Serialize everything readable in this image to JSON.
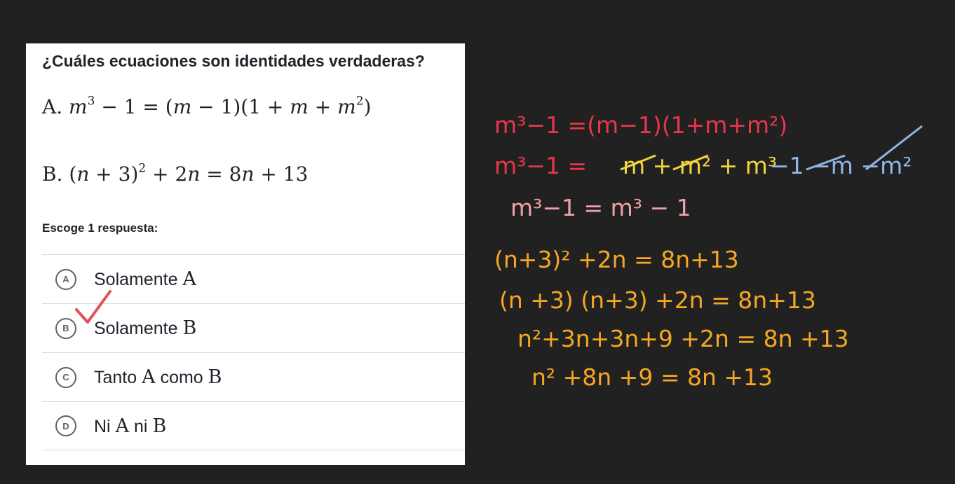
{
  "question": {
    "title": "¿Cuáles ecuaciones son identidades verdaderas?",
    "equation_a": {
      "label": "A.",
      "m": "m",
      "e1": "3",
      "rest1": "− 1 = (",
      "m2": "m",
      "rest2": "− 1)(1 +",
      "m3": "m",
      "rest3": "+",
      "m4": "m",
      "e2": "2",
      "rest4": ")"
    },
    "equation_b": {
      "label": "B.",
      "open": "(",
      "n1": "n",
      "rest1": "+ 3)",
      "e1": "2",
      "rest2": "+ 2",
      "n2": "n",
      "rest3": "= 8",
      "n3": "n",
      "rest4": "+ 13"
    },
    "prompt": "Escoge 1 respuesta:"
  },
  "choices": [
    {
      "letter": "A",
      "text": "Solamente",
      "math": "A",
      "checked": true
    },
    {
      "letter": "B",
      "text": "Solamente",
      "math": "B"
    },
    {
      "letter": "C",
      "text": "Tanto",
      "math": "A",
      "text2": "como",
      "math2": "B"
    },
    {
      "letter": "D",
      "text": "Ni",
      "math": "A",
      "text2": "ni",
      "math2": "B"
    }
  ],
  "scratch_notes": {
    "line1": "m³−1 =(m−1)(1+m+m²)",
    "line2a": "m³−1 =",
    "line2b": "m + m² + m³",
    "line2c": "−1 −m −m²",
    "line3": "m³−1 = m³ − 1",
    "line4": "(n+3)² +2n = 8n+13",
    "line5": "(n +3) (n+3) +2n = 8n+13",
    "line6": "n²+3n+3n+9 +2n = 8n +13",
    "line7": "n² +8n +9 = 8n +13"
  },
  "colors": {
    "background": "#212121",
    "card": "#ffffff",
    "text": "#21242c",
    "check": "#e0505a",
    "note_red": "#e8364a",
    "note_yellow": "#f2d53c",
    "note_blue": "#8fb8e8",
    "note_orange": "#f5a623",
    "note_pink": "#f2a0a8"
  },
  "icons": {
    "check": "checkmark-icon"
  }
}
